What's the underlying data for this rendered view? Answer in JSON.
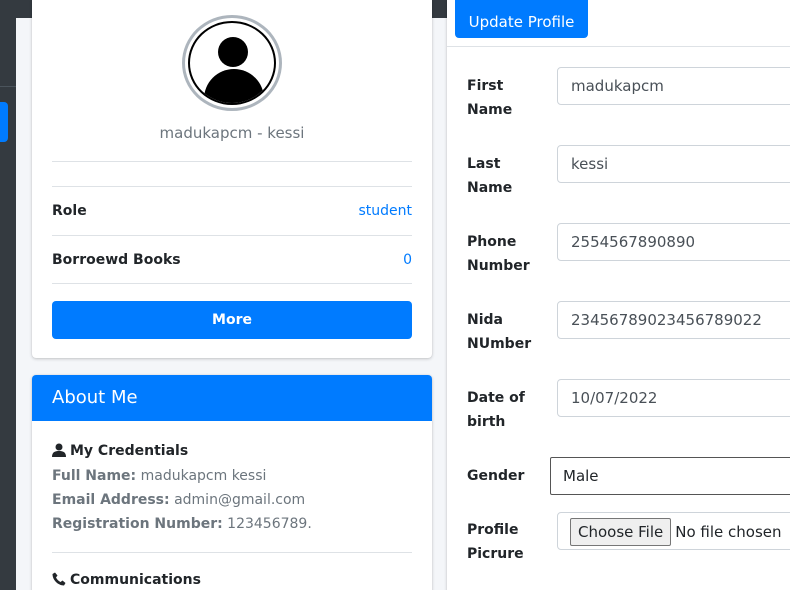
{
  "profile": {
    "name": "madukapcm - kessi",
    "rows": [
      {
        "label": "Role",
        "value": "student"
      },
      {
        "label": "Borroewd Books",
        "value": "0"
      }
    ],
    "more_label": "More"
  },
  "about": {
    "title": "About Me",
    "credentials_title": "My Credentials",
    "full_name_label": "Full Name:",
    "full_name": "madukapcm kessi",
    "email_label": "Email Address:",
    "email": "admin@gmail.com",
    "reg_label": "Registration Number:",
    "reg_number": "123456789.",
    "communications_title": "Communications"
  },
  "form": {
    "update_label": "Update Profile",
    "first_name_label": "First Name",
    "first_name": "madukapcm",
    "last_name_label": "Last Name",
    "last_name": "kessi",
    "phone_label": "Phone Number",
    "phone": "2554567890890",
    "nida_label": "Nida NUmber",
    "nida": "23456789023456789022",
    "dob_label": "Date of birth",
    "dob": "10/07/2022",
    "gender_label": "Gender",
    "gender": "Male",
    "picture_label": "Profile Picrure",
    "choose_file": "Choose File",
    "no_file": "No file chosen"
  },
  "icons": {
    "avatar": "user-silhouette-icon",
    "credentials": "user-icon",
    "communications": "phone-icon"
  },
  "colors": {
    "primary": "#007bff",
    "sidebar": "#343a40"
  }
}
